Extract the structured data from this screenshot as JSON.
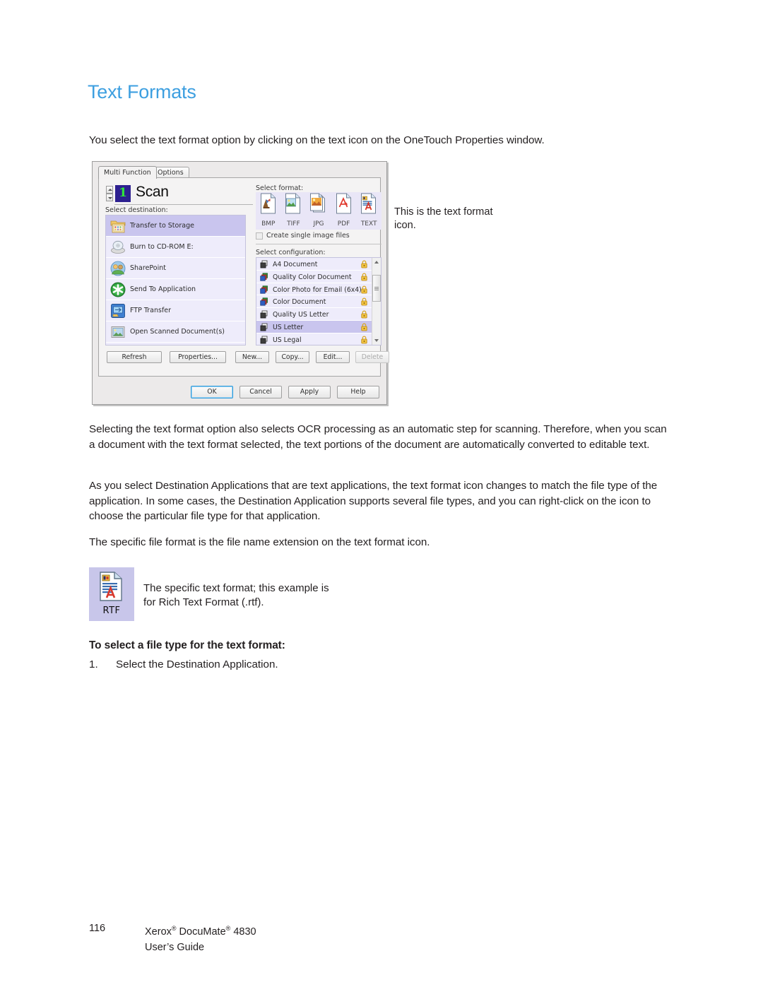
{
  "document": {
    "title": "Text Formats",
    "title_color": "#3d9fe0",
    "paragraphs": {
      "intro": "You select the text format option by clicking on the text icon on the OneTouch Properties window.",
      "ocr": "Selecting the text format option also selects OCR processing as an automatic step for scanning. Therefore, when you scan a document with the text format selected, the text portions of the document are automatically converted to editable text.",
      "destination_apps": "As you select Destination Applications that are text applications, the text format icon changes to match the file type of the application. In some cases, the Destination Application supports several file types, and you can right-click on the icon to choose the particular file type for that application.",
      "specific_format": "The specific file format is the file name extension on the text format icon."
    },
    "callout_right": "This is the text format icon.",
    "rtf": {
      "badge_label": "RTF",
      "caption": "The specific text format; this example is for Rich Text Format (.rtf)."
    },
    "procedure": {
      "heading": "To select a file type for the text format:",
      "steps": [
        {
          "number": "1.",
          "text": "Select the Destination Application."
        }
      ]
    },
    "footer": {
      "page_number": "116",
      "product_line": "Xerox® DocuMate® 4830",
      "guide_line": "User’s Guide"
    }
  },
  "dialog": {
    "tabs": [
      {
        "label": "Multi Function",
        "active": true
      },
      {
        "label": "Options",
        "active": false
      }
    ],
    "scan_header": {
      "number": "1",
      "title": "Scan"
    },
    "labels": {
      "select_destination": "Select destination:",
      "select_format": "Select format:",
      "select_configuration": "Select configuration:"
    },
    "destinations": [
      {
        "label": "Transfer to Storage",
        "icon": "folder-storage-icon",
        "selected": true
      },
      {
        "label": "Burn to CD-ROM  E:",
        "icon": "cd-burner-icon",
        "selected": false
      },
      {
        "label": "SharePoint",
        "icon": "sharepoint-icon",
        "selected": false
      },
      {
        "label": "Send To Application",
        "icon": "send-to-app-icon",
        "selected": false
      },
      {
        "label": "FTP Transfer",
        "icon": "ftp-transfer-icon",
        "selected": false
      },
      {
        "label": "Open Scanned Document(s)",
        "icon": "open-scanned-icon",
        "selected": false
      }
    ],
    "formats": [
      {
        "label": "BMP",
        "icon": "bmp-format-icon"
      },
      {
        "label": "TIFF",
        "icon": "tiff-format-icon"
      },
      {
        "label": "JPG",
        "icon": "jpg-format-icon"
      },
      {
        "label": "PDF",
        "icon": "pdf-format-icon"
      },
      {
        "label": "TEXT",
        "icon": "text-format-icon"
      }
    ],
    "create_single_image_files": {
      "label": "Create single image files",
      "checked": false
    },
    "configurations": [
      {
        "label": "A4 Document",
        "icon": "bw-config-icon",
        "selected": false
      },
      {
        "label": "Quality Color Document",
        "icon": "color-config-icon",
        "selected": false
      },
      {
        "label": "Color Photo for Email (6x4)",
        "icon": "color-config-icon",
        "selected": false
      },
      {
        "label": "Color Document",
        "icon": "color-config-icon",
        "selected": false
      },
      {
        "label": "Quality US Letter",
        "icon": "bw-config-icon",
        "selected": false
      },
      {
        "label": "US Letter",
        "icon": "bw-config-icon",
        "selected": true
      },
      {
        "label": "US Legal",
        "icon": "bw-config-icon",
        "selected": false
      }
    ],
    "list_buttons": [
      {
        "label": "Refresh",
        "disabled": false
      },
      {
        "label": "Properties...",
        "disabled": false
      },
      {
        "label": "New...",
        "disabled": false
      },
      {
        "label": "Copy...",
        "disabled": false
      },
      {
        "label": "Edit...",
        "disabled": false
      },
      {
        "label": "Delete",
        "disabled": true
      }
    ],
    "dialog_buttons": [
      {
        "label": "OK",
        "focused": true
      },
      {
        "label": "Cancel",
        "focused": false
      },
      {
        "label": "Apply",
        "focused": false
      },
      {
        "label": "Help",
        "focused": false
      }
    ]
  }
}
